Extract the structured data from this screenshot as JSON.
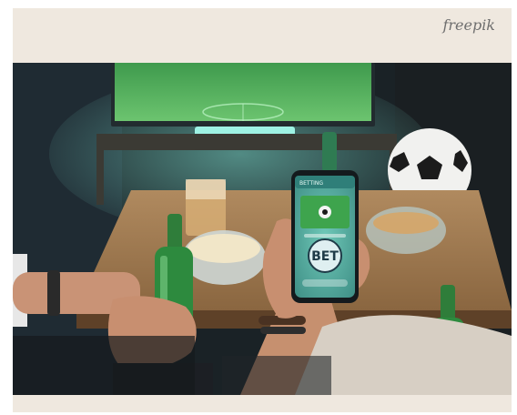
{
  "watermark": {
    "text": "freepik"
  },
  "photo": {
    "phone": {
      "app_header": "BETTING",
      "bet_label": "BET"
    }
  },
  "colors": {
    "card_background": "#efe8df",
    "tv_screen": "#4faa5c",
    "bet_button": "#dfeff1",
    "bet_text": "#1f3b48"
  },
  "icons": [
    "soccer-ball-icon",
    "beer-bottle-icon"
  ]
}
